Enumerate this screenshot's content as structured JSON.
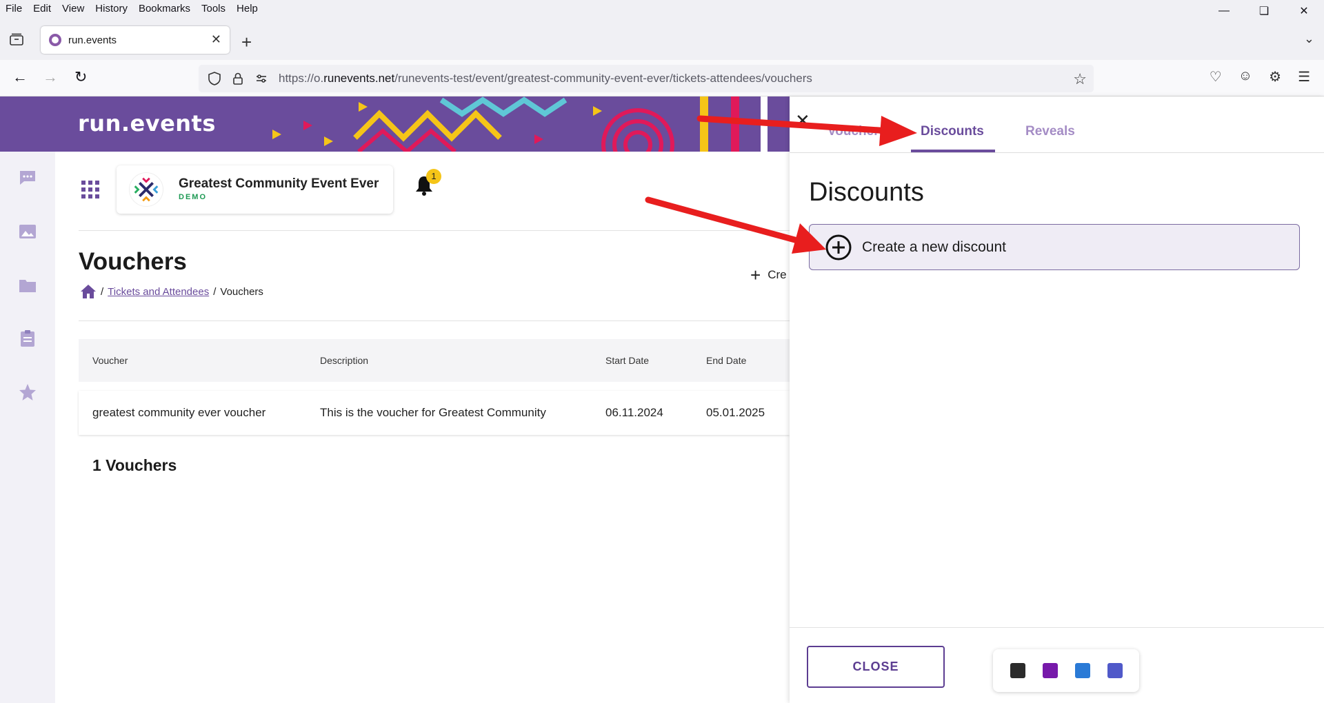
{
  "browser": {
    "menu": [
      "File",
      "Edit",
      "View",
      "History",
      "Bookmarks",
      "Tools",
      "Help"
    ],
    "tab_title": "run.events",
    "url_prefix": "https://o.",
    "url_domain": "runevents.net",
    "url_path": "/runevents-test/event/greatest-community-event-ever/tickets-attendees/vouchers"
  },
  "app": {
    "logo": "run.events",
    "event_name": "Greatest Community Event Ever",
    "event_tag": "DEMO",
    "notification_count": "1",
    "page_title": "Vouchers",
    "breadcrumb_link": "Tickets and Attendees",
    "breadcrumb_current": "Vouchers",
    "create_label": "Cre",
    "table": {
      "headers": [
        "Voucher",
        "Description",
        "Start Date",
        "End Date"
      ],
      "rows": [
        {
          "voucher": "greatest community ever voucher",
          "description": "This is the voucher for Greatest Community",
          "start": "06.11.2024",
          "end": "05.01.2025"
        }
      ]
    },
    "count_label": "1 Vouchers"
  },
  "panel": {
    "tabs": [
      "Vouchers",
      "Discounts",
      "Reveals"
    ],
    "active_tab": "Discounts",
    "title": "Discounts",
    "create_label": "Create a new discount",
    "close_label": "CLOSE"
  },
  "colors": {
    "brand": "#6a4c9c",
    "arrow": "#e81e1e",
    "demo": "#1e9a54"
  }
}
